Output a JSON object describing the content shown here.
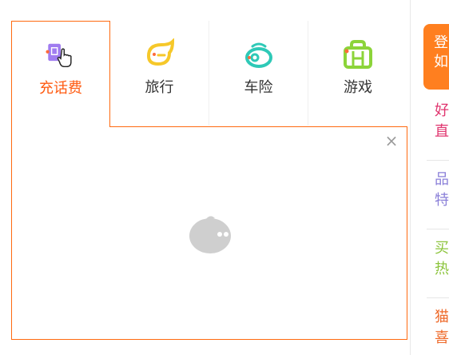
{
  "tabs": [
    {
      "label": "充话费",
      "icon": "phone-card-icon",
      "active": true
    },
    {
      "label": "旅行",
      "icon": "travel-icon",
      "active": false
    },
    {
      "label": "车险",
      "icon": "car-insurance-icon",
      "active": false
    },
    {
      "label": "游戏",
      "icon": "game-controller-icon",
      "active": false
    }
  ],
  "panel": {
    "close_label": "×",
    "loader": "loading-mascot-icon"
  },
  "sidebar": {
    "header": [
      "登",
      "如"
    ],
    "items": [
      {
        "line1": "好",
        "line2": "直",
        "color": "#e0346e"
      },
      {
        "line1": "品",
        "line2": "特",
        "color": "#8a7fd8"
      },
      {
        "line1": "买",
        "line2": "热",
        "color": "#8cc43c"
      },
      {
        "line1": "猫",
        "line2": "喜",
        "color": "#ee6a2a"
      }
    ]
  },
  "colors": {
    "accent": "#ff6a10",
    "icon_purple": "#a07cf0",
    "icon_yellow": "#f6c82a",
    "icon_teal": "#2ec9b7",
    "icon_green": "#8cd43a"
  }
}
